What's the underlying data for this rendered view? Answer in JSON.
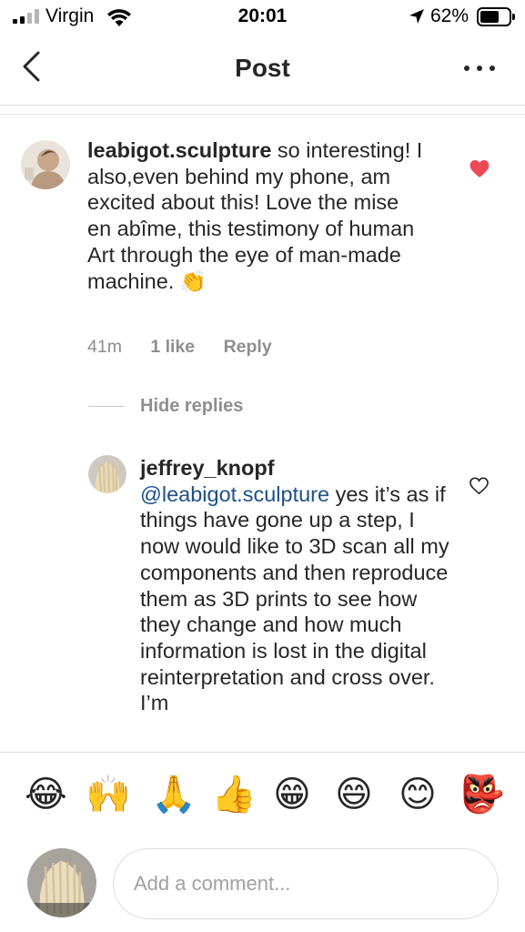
{
  "status_bar": {
    "carrier": "Virgin",
    "time": "20:01",
    "battery_pct": "62%",
    "battery_level": 0.62,
    "icons": [
      "signal-icon",
      "wifi-icon",
      "location-arrow-icon",
      "battery-icon"
    ]
  },
  "nav": {
    "title": "Post",
    "back_icon": "chevron-left-icon",
    "more_icon": "more-horizontal-icon"
  },
  "comment": {
    "username": "leabigot.sculpture",
    "text": " so interesting! I also,even behind my phone, am excited about this! Love the mise en abîme, this testimony of human Art through the eye of man-made machine. 👏",
    "time": "41m",
    "likes": "1 like",
    "reply": "Reply",
    "liked": true,
    "heart_color": "#ed4956"
  },
  "replies_toggle": "Hide replies",
  "reply": {
    "username": "jeffrey_knopf",
    "mention": "@leabigot.sculpture",
    "text": " yes it’s as if things have gone up a step, I now would like to 3D scan all my components and then reproduce them as 3D prints to see how they change and how much information is lost in the digital reinterpretation and cross over. I’m",
    "liked": false
  },
  "emoji_bar": [
    "😂",
    "🙌",
    "🙏",
    "👍",
    "😁",
    "😄",
    "😊",
    "👺"
  ],
  "composer": {
    "placeholder": "Add a comment..."
  },
  "colors": {
    "text": "#262626",
    "muted": "#8e8e8e",
    "mention": "#1d4f8b",
    "border": "#dbdbdb"
  }
}
